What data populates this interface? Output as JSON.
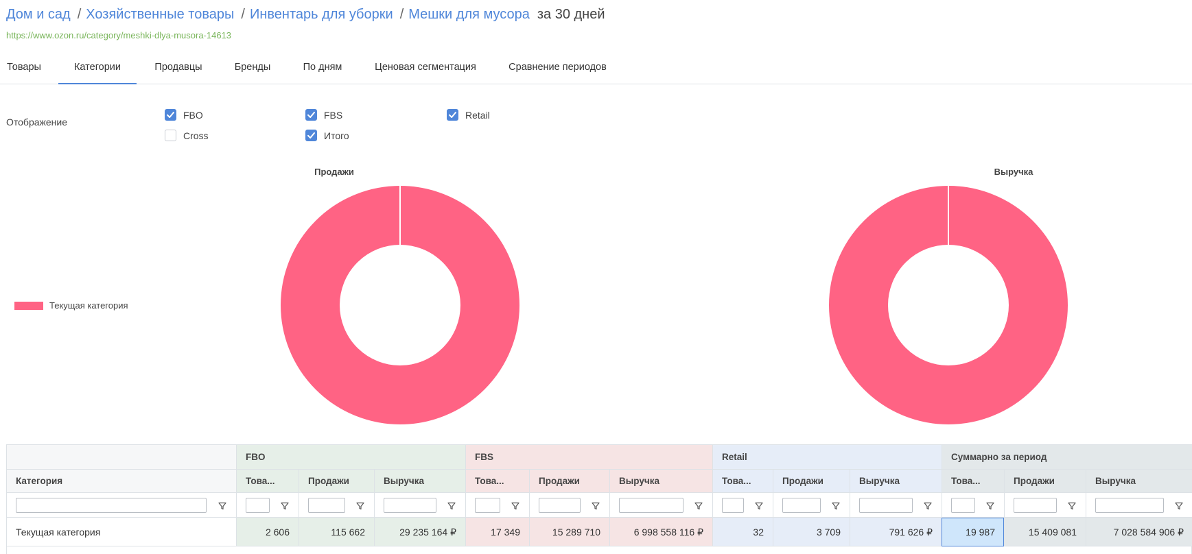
{
  "breadcrumbs": [
    {
      "label": "Дом и сад"
    },
    {
      "label": "Хозяйственные товары"
    },
    {
      "label": "Инвентарь для уборки"
    },
    {
      "label": "Мешки для мусора"
    }
  ],
  "breadcrumb_separator": "/",
  "period_label": "за 30 дней",
  "category_url": "https://www.ozon.ru/category/meshki-dlya-musora-14613",
  "tabs": [
    {
      "label": "Товары",
      "active": false
    },
    {
      "label": "Категории",
      "active": true
    },
    {
      "label": "Продавцы",
      "active": false
    },
    {
      "label": "Бренды",
      "active": false
    },
    {
      "label": "По дням",
      "active": false
    },
    {
      "label": "Ценовая сегментация",
      "active": false
    },
    {
      "label": "Сравнение периодов",
      "active": false
    }
  ],
  "display": {
    "label": "Отображение",
    "options": [
      {
        "label": "FBO",
        "checked": true
      },
      {
        "label": "FBS",
        "checked": true
      },
      {
        "label": "Retail",
        "checked": true
      },
      {
        "label": "Cross",
        "checked": false
      },
      {
        "label": "Итого",
        "checked": true
      }
    ]
  },
  "colors": {
    "accent": "#4f86d9",
    "category_slice": "#ff6384",
    "fbo_bg": "#e6efe8",
    "fbs_bg": "#f6e4e4",
    "retail_bg": "#e6edf8",
    "total_bg": "#e3e8ea",
    "url": "#79b55a"
  },
  "chart_data": [
    {
      "type": "pie",
      "title": "Продажи",
      "categories": [
        "Текущая категория"
      ],
      "values": [
        100
      ],
      "legend": "left"
    },
    {
      "type": "pie",
      "title": "Выручка",
      "categories": [
        "Текущая категория"
      ],
      "values": [
        100
      ],
      "legend": "left"
    }
  ],
  "legend": {
    "label": "Текущая категория"
  },
  "table": {
    "groups": [
      {
        "label": ""
      },
      {
        "label": "FBO"
      },
      {
        "label": "FBS"
      },
      {
        "label": "Retail"
      },
      {
        "label": "Суммарно за период"
      }
    ],
    "columns": [
      {
        "label": "Категория"
      },
      {
        "label": "Това..."
      },
      {
        "label": "Продажи"
      },
      {
        "label": "Выручка"
      },
      {
        "label": "Това..."
      },
      {
        "label": "Продажи"
      },
      {
        "label": "Выручка"
      },
      {
        "label": "Това..."
      },
      {
        "label": "Продажи"
      },
      {
        "label": "Выручка"
      },
      {
        "label": "Това..."
      },
      {
        "label": "Продажи"
      },
      {
        "label": "Выручка"
      }
    ],
    "rows": [
      {
        "cells": [
          "Текущая категория",
          "2 606",
          "115 662",
          "29 235 164 ₽",
          "17 349",
          "15 289 710",
          "6 998 558 116 ₽",
          "32",
          "3 709",
          "791 626 ₽",
          "19 987",
          "15 409 081",
          "7 028 584 906 ₽"
        ]
      }
    ],
    "selected_cell": "19 987"
  }
}
